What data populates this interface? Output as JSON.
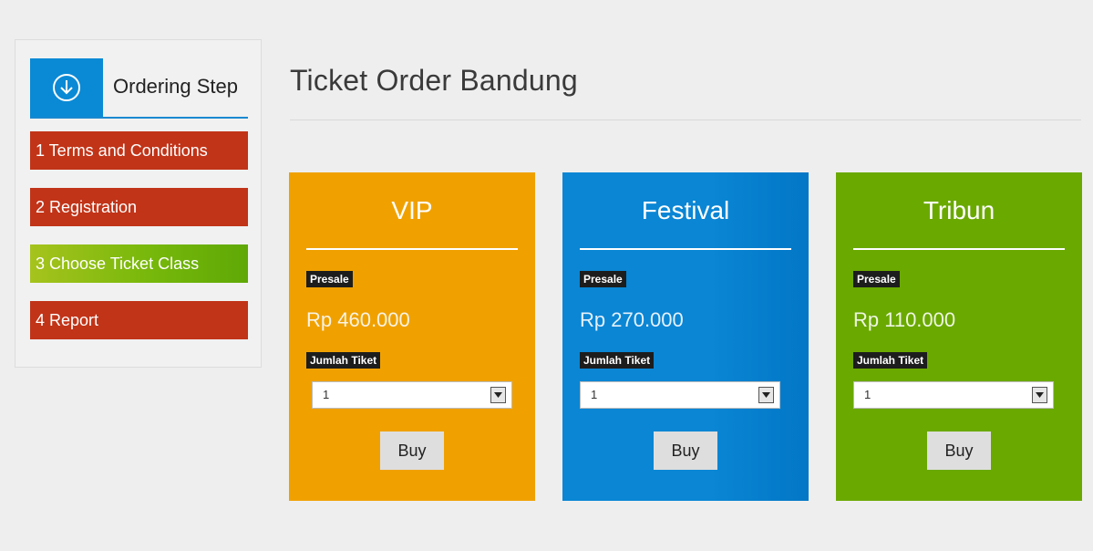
{
  "sidebar": {
    "title": "Ordering Step",
    "steps": [
      {
        "label": "1 Terms and Conditions"
      },
      {
        "label": "2 Registration"
      },
      {
        "label": "3 Choose Ticket Class"
      },
      {
        "label": "4 Report"
      }
    ],
    "active_step": "3 Choose Ticket Class"
  },
  "main": {
    "title": "Ticket Order Bandung",
    "cards": [
      {
        "name": "VIP",
        "presale_label": "Presale",
        "price": "Rp 460.000",
        "qty_label": "Jumlah Tiket",
        "qty_value": "1",
        "buy_label": "Buy",
        "color": "#f0a100"
      },
      {
        "name": "Festival",
        "presale_label": "Presale",
        "price": "Rp 270.000",
        "qty_label": "Jumlah Tiket",
        "qty_value": "1",
        "buy_label": "Buy",
        "color": "#0a86d4"
      },
      {
        "name": "Tribun",
        "presale_label": "Presale",
        "price": "Rp 110.000",
        "qty_label": "Jumlah Tiket",
        "qty_value": "1",
        "buy_label": "Buy",
        "color": "#6aa900"
      }
    ]
  },
  "icons": {
    "sidebar_header": "arrow-down-circle-icon",
    "select_arrow": "dropdown-arrow-icon"
  },
  "colors": {
    "header_icon_bg": "#0a8ad5",
    "step_default": "#c13418",
    "step_active": "#77b80b",
    "tag_bg": "#1d1d1d"
  }
}
